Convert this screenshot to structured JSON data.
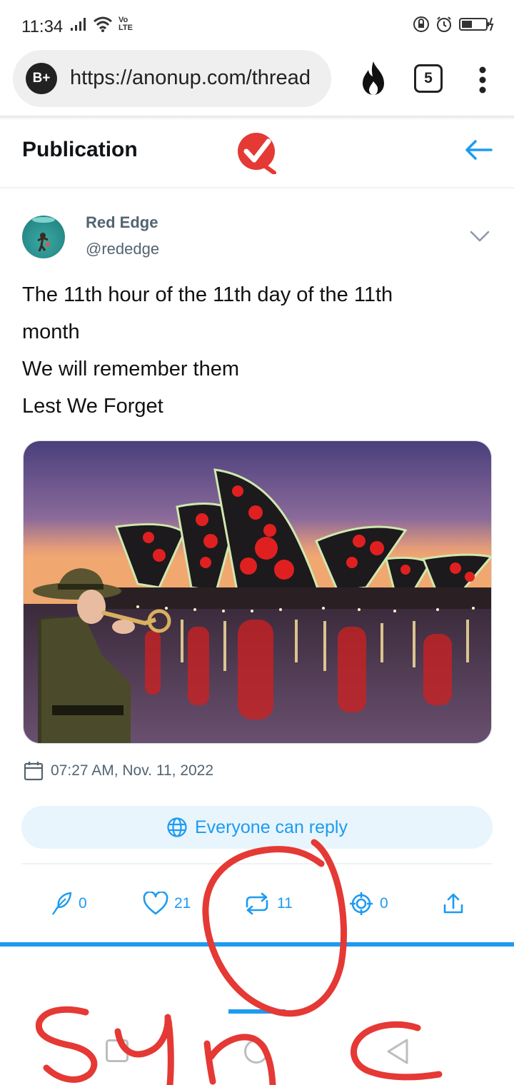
{
  "status_bar": {
    "time": "11:34",
    "network_label": "Vo LTE"
  },
  "browser": {
    "badge_label": "B+",
    "url": "https://anonup.com/thread",
    "tab_count": "5"
  },
  "header": {
    "title": "Publication"
  },
  "post": {
    "author_name": "Red Edge",
    "author_handle": "@rededge",
    "lines": [
      "The 11th hour of the 11th day of the 11th",
      "month",
      "We will remember them",
      "Lest We Forget"
    ],
    "timestamp": "07:27 AM, Nov. 11, 2022",
    "reply_setting": "Everyone can reply"
  },
  "actions": {
    "reply_count": "0",
    "like_count": "21",
    "repost_count": "11",
    "target_count": "0"
  },
  "annotation": {
    "handwritten_text": "Sync",
    "color": "#e53935"
  },
  "colors": {
    "accent": "#1d9bf0",
    "muted": "#536471",
    "brand_red": "#e53935"
  }
}
